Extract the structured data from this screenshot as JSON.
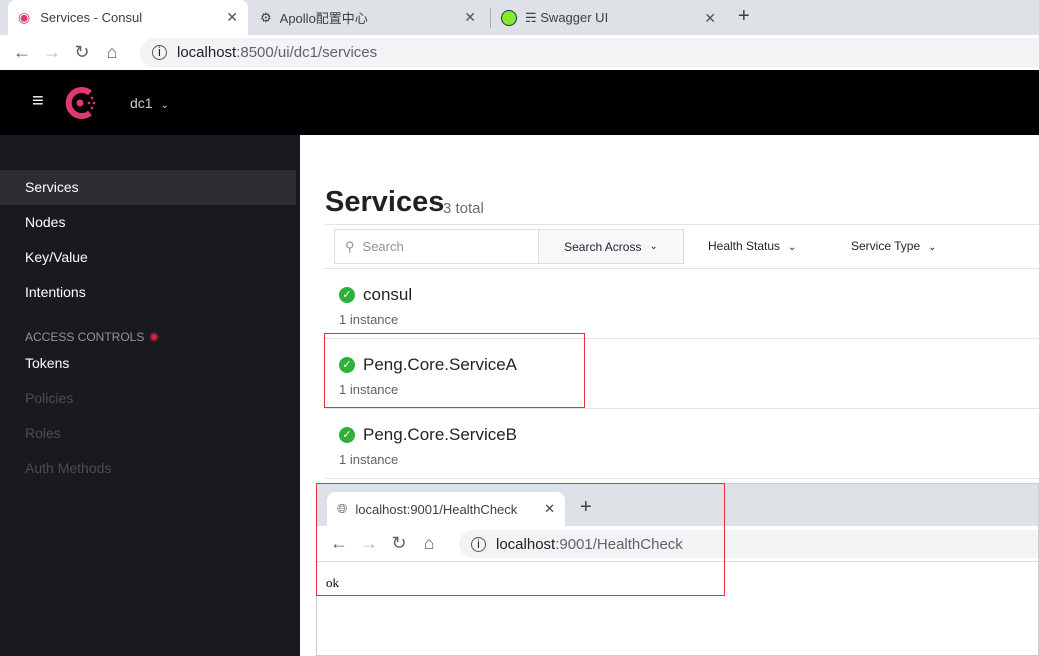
{
  "browser": {
    "tabs": [
      {
        "title": "Services - Consul",
        "active": true
      },
      {
        "title": "Apollo配置中心"
      },
      {
        "title": "☴ Swagger UI"
      }
    ],
    "url_host": "localhost",
    "url_rest": ":8500/ui/dc1/services"
  },
  "consul": {
    "datacenter": "dc1",
    "brand_color": "#e03875",
    "nav": [
      {
        "label": "Services",
        "selected": true
      },
      {
        "label": "Nodes"
      },
      {
        "label": "Key/Value"
      },
      {
        "label": "Intentions"
      }
    ],
    "access_controls": {
      "heading": "ACCESS CONTROLS",
      "items": [
        {
          "label": "Tokens"
        },
        {
          "label": "Policies",
          "disabled": true
        },
        {
          "label": "Roles",
          "disabled": true
        },
        {
          "label": "Auth Methods",
          "disabled": true
        }
      ]
    },
    "page": {
      "title": "Services",
      "count": "3 total"
    },
    "filters": {
      "search_placeholder": "Search",
      "search_across": "Search Across",
      "health_status": "Health Status",
      "service_type": "Service Type"
    },
    "services": [
      {
        "name": "consul",
        "instances": "1 instance",
        "status": "passing"
      },
      {
        "name": "Peng.Core.ServiceA",
        "instances": "1 instance",
        "status": "passing"
      },
      {
        "name": "Peng.Core.ServiceB",
        "instances": "1 instance",
        "status": "passing"
      }
    ]
  },
  "popup": {
    "tab_title": "localhost:9001/HealthCheck",
    "url_host": "localhost",
    "url_rest": ":9001/HealthCheck",
    "body": "ok"
  }
}
